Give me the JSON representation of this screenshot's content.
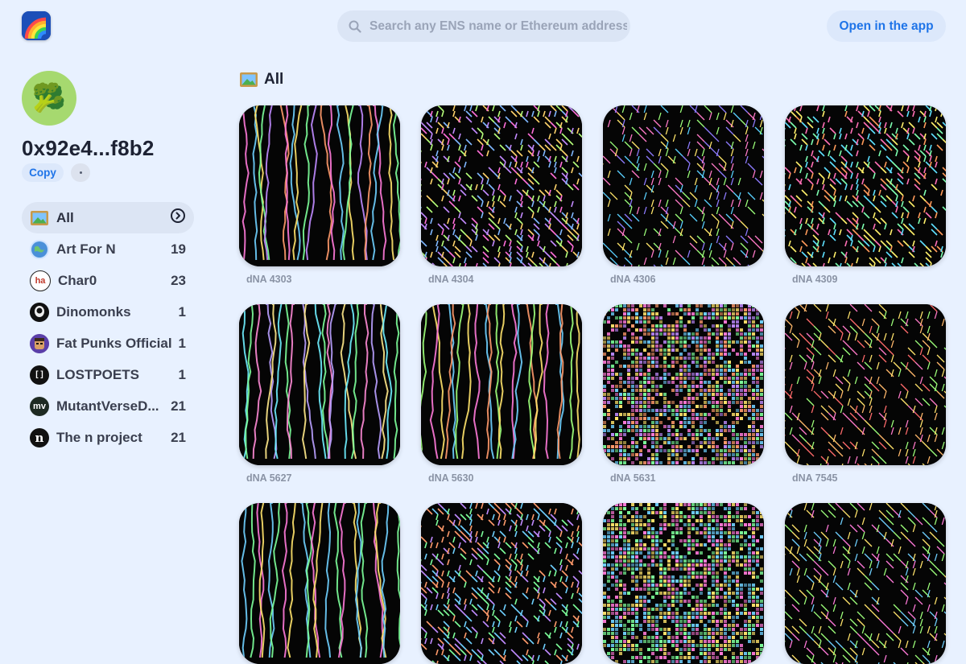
{
  "header": {
    "logo": "rainbow-logo",
    "search_placeholder": "Search any ENS name or Ethereum address",
    "open_app_label": "Open in the app"
  },
  "profile": {
    "avatar_emoji": "🥦",
    "address": "0x92e4...f8b2",
    "copy_label": "Copy"
  },
  "sidebar": {
    "items": [
      {
        "label": "All",
        "count": "",
        "icon": "picture-frame-icon"
      },
      {
        "label": "Art For N",
        "count": "19",
        "icon": "globe-icon"
      },
      {
        "label": "Char0",
        "count": "23",
        "icon": "char0-icon"
      },
      {
        "label": "Dinomonks",
        "count": "1",
        "icon": "dinomonks-icon"
      },
      {
        "label": "Fat Punks Official",
        "count": "1",
        "icon": "fatpunks-icon"
      },
      {
        "label": "LOSTPOETS",
        "count": "1",
        "icon": "lostpoets-icon"
      },
      {
        "label": "MutantVerseD...",
        "count": "21",
        "icon": "mv-icon"
      },
      {
        "label": "The n project",
        "count": "21",
        "icon": "n-icon"
      }
    ]
  },
  "main": {
    "section_title": "All",
    "cards": [
      {
        "label": "dNA 4303",
        "style": "verticals",
        "palette": [
          "#ff7ad9",
          "#6fd0ff",
          "#ffe36b",
          "#7dff9a",
          "#c08bff",
          "#ff9a6b"
        ]
      },
      {
        "label": "dNA 4304",
        "style": "dense",
        "palette": [
          "#ff6fd8",
          "#7fb7ff",
          "#b6ff7a",
          "#c38bff",
          "#ffd36b"
        ]
      },
      {
        "label": "dNA 4306",
        "style": "mesh",
        "palette": [
          "#5ad1ff",
          "#9bff7a",
          "#ff7ac8",
          "#ffe66b",
          "#8e7bff"
        ]
      },
      {
        "label": "dNA 4309",
        "style": "dense",
        "palette": [
          "#ff6fb5",
          "#5ee0ff",
          "#fff06b",
          "#ff9a5a",
          "#7dffb0"
        ]
      },
      {
        "label": "dNA 5627",
        "style": "verticals",
        "palette": [
          "#6ff0ff",
          "#7dff9a",
          "#ff8bd6",
          "#b9a0ff",
          "#ffe98a"
        ]
      },
      {
        "label": "dNA 5630",
        "style": "verticals",
        "palette": [
          "#9dff7a",
          "#ffe36b",
          "#ff7ad9",
          "#6fd0ff",
          "#ff9a6b"
        ]
      },
      {
        "label": "dNA 5631",
        "style": "noise",
        "palette": [
          "#ffe36b",
          "#7dff9a",
          "#ff7ad9",
          "#6fd0ff",
          "#ff9a6b",
          "#c08bff"
        ]
      },
      {
        "label": "dNA 7545",
        "style": "mesh",
        "palette": [
          "#ff6b6b",
          "#ffb86b",
          "#ffe36b",
          "#9dff7a",
          "#ff7ac8"
        ]
      },
      {
        "label": "",
        "style": "verticals",
        "palette": [
          "#6fd0ff",
          "#7dff9a",
          "#ff7ad9",
          "#ffe36b"
        ]
      },
      {
        "label": "",
        "style": "dense",
        "palette": [
          "#ff9a6b",
          "#c08bff",
          "#6fd0ff",
          "#7dff9a"
        ]
      },
      {
        "label": "",
        "style": "noise",
        "palette": [
          "#7dff9a",
          "#6fd0ff",
          "#ffe36b",
          "#ff7ad9"
        ]
      },
      {
        "label": "",
        "style": "mesh",
        "palette": [
          "#ff7ad9",
          "#6fd0ff",
          "#ffe36b",
          "#9dff7a"
        ]
      }
    ]
  },
  "colors": {
    "background": "#e8f1ff",
    "accent": "#1f74e8",
    "avatar_bg": "#a6d96f"
  }
}
